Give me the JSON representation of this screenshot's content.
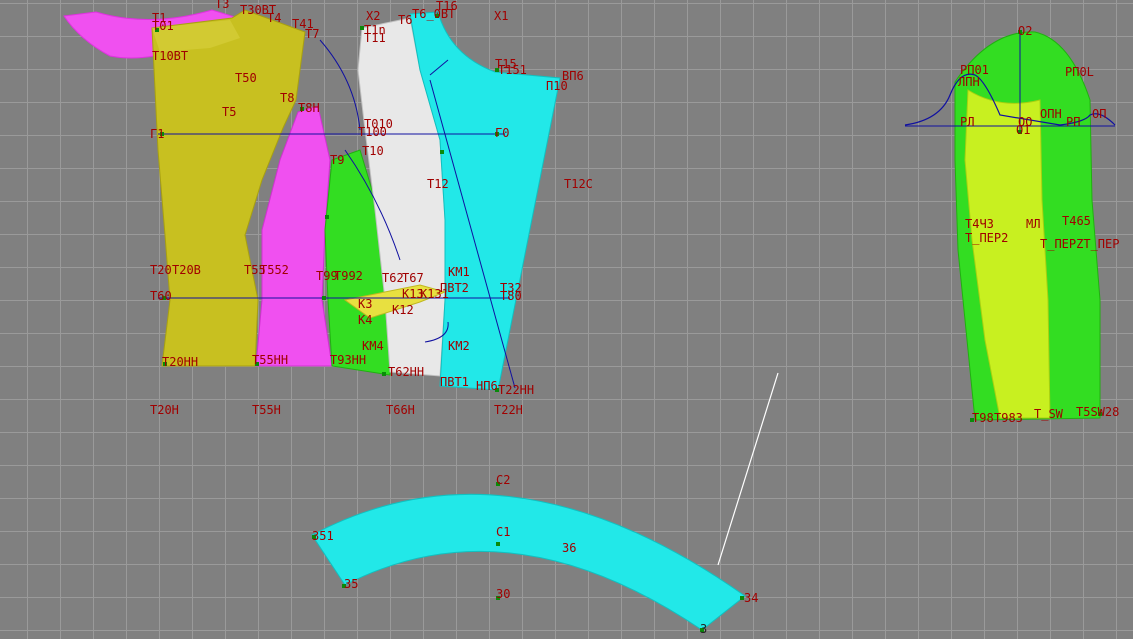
{
  "colors": {
    "background": "#808080",
    "grid": "#9a9a9a",
    "point_label": "#a00000",
    "construction_line": "#1010a0",
    "yellow_panel": "#c8c020",
    "magenta_panel": "#f050f0",
    "green_panel": "#33dd22",
    "white_panel": "#e8e8e8",
    "cyan_panel": "#22e8e8",
    "sleeve_light": "#c8f020"
  },
  "labels": {
    "t1": "T1",
    "t01": "T01",
    "t3": "T3",
    "t30bt": "T30BT",
    "t4": "T4",
    "t41": "T41",
    "t7": "T7",
    "t10bt": "T10BT",
    "t50": "T50",
    "t5": "T5",
    "t8": "T8",
    "t8n": "T8H",
    "g1": "Г1",
    "t20": "T20",
    "t20b": "T20B",
    "t55": "T55",
    "t552": "T552",
    "t60": "T60",
    "t20hh": "T20HH",
    "t55hh": "T55HH",
    "t20h": "T20H",
    "t55h": "T55H",
    "x2": "X2",
    "t6": "T6",
    "t6bt": "T6_0BT",
    "x1": "X1",
    "t11": "T11",
    "t1n": "T1n",
    "t15": "T15",
    "t151": "T151",
    "vp6": "BП6",
    "p10": "П10",
    "t010": "T010",
    "t100": "T100",
    "t16": "T16",
    "t10": "T10",
    "g0": "Г0",
    "t9": "T9",
    "t12": "T12",
    "t12c": "T12C",
    "t99": "T99",
    "t992": "T992",
    "t62": "T62",
    "t67": "T67",
    "km1": "KM1",
    "k13": "K13",
    "k131": "K131",
    "t32": "T32",
    "t80": "T80",
    "k3": "K3",
    "k4": "K4",
    "k12": "K12",
    "km4": "KM4",
    "km2": "KM2",
    "t62hh": "T62HH",
    "pbt1": "ПBT1",
    "np6": "HП6",
    "t22hh": "T22HH",
    "t66h": "T66H",
    "t22h": "T22H",
    "pbt2": "ПBT2",
    "t93hh": "T93HH",
    "o2": "O2",
    "rp01": "PП01",
    "rp0l": "PП0L",
    "lpn": "ЛПH",
    "opn": "OПH",
    "op": "OП",
    "rl": "PЛ",
    "o1": "O1",
    "oo": "OO",
    "rp": "PП",
    "t4ch": "T4Ч3",
    "t_perz": "T_ПЕР2",
    "ml": "MЛ",
    "t465": "T465",
    "t_perz2": "T_ПЕРZT_ПЕР",
    "t98": "T98",
    "t983": "T983",
    "t_sw": "T_SW",
    "t5sw": "T5SW28",
    "c2": "C2",
    "c1": "C1",
    "c5": "35",
    "c6": "36",
    "c51": "351",
    "c0": "30",
    "c4": "34",
    "c3": "3"
  }
}
